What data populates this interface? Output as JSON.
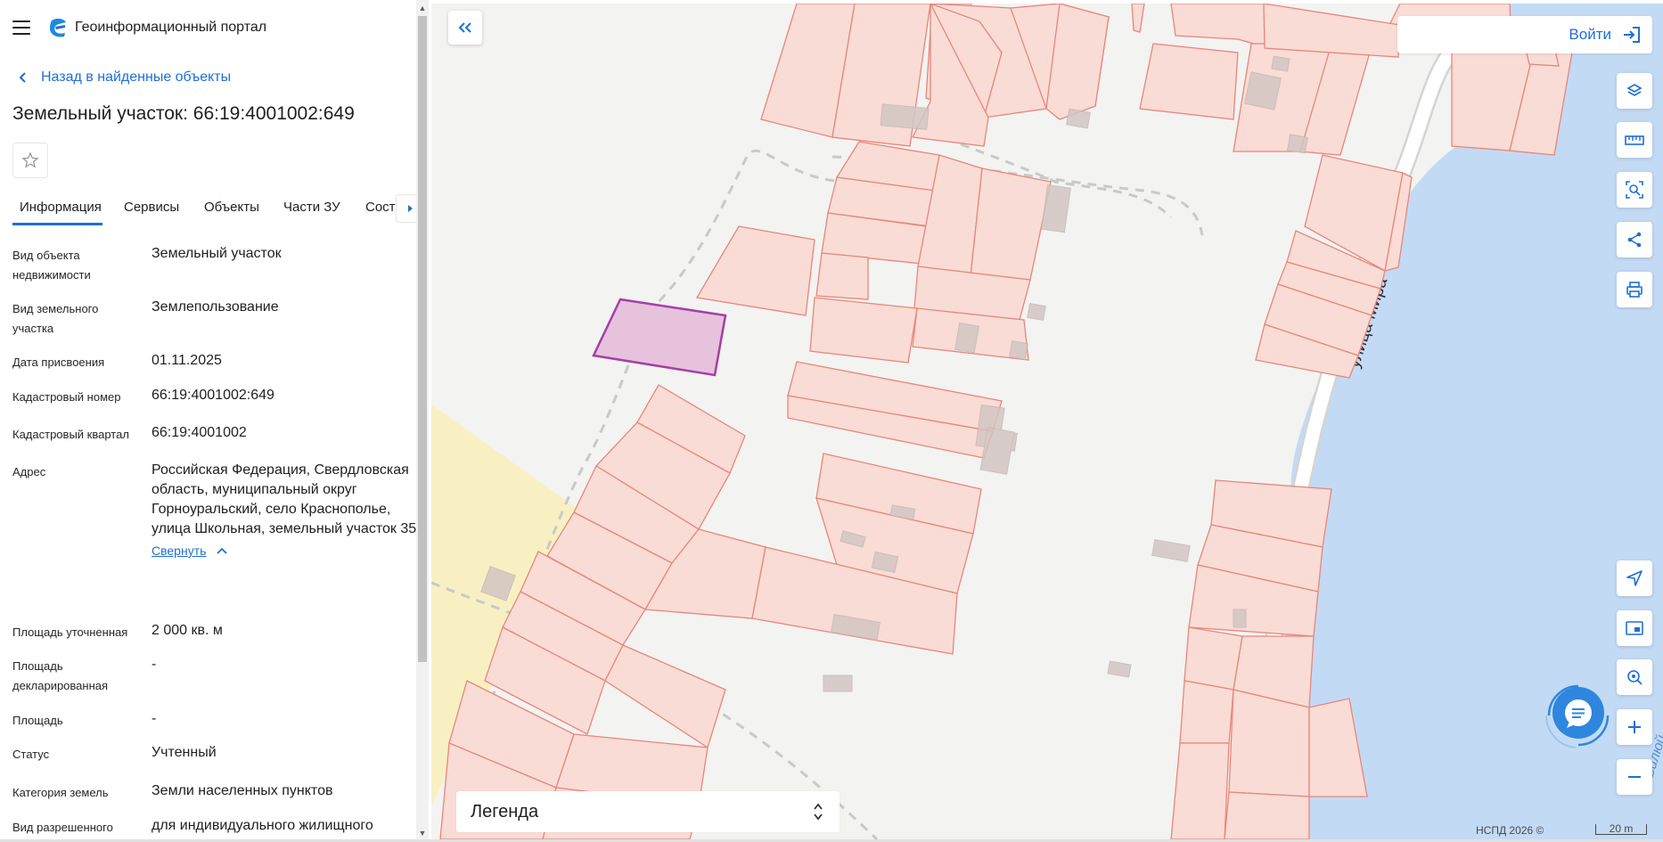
{
  "app": {
    "title": "Геоинформационный портал",
    "back_label": "Назад в найденные объекты",
    "object_title": "Земельный участок: 66:19:4001002:649"
  },
  "tabs": [
    {
      "label": "Информация",
      "active": true
    },
    {
      "label": "Сервисы",
      "active": false
    },
    {
      "label": "Объекты",
      "active": false
    },
    {
      "label": "Части ЗУ",
      "active": false
    },
    {
      "label": "Состав ЗУ",
      "active": false
    }
  ],
  "info": {
    "object_type": {
      "label": "Вид объекта недвижимости",
      "value": "Земельный участок"
    },
    "land_type": {
      "label": "Вид земельного участка",
      "value": "Землепользование"
    },
    "date_assigned": {
      "label": "Дата присвоения",
      "value": "01.11.2025"
    },
    "cadastral_number": {
      "label": "Кадастровый номер",
      "value": "66:19:4001002:649"
    },
    "cadastral_quarter": {
      "label": "Кадастровый квартал",
      "value": "66:19:4001002"
    },
    "address": {
      "label": "Адрес",
      "value": "Российская Федерация, Свердловская область, муниципальный округ Горноуральский, село Краснополье, улица Школьная, земельный участок 35",
      "collapse_label": "Свернуть"
    },
    "area_specified": {
      "label": "Площадь уточненная",
      "value": "2 000 кв. м"
    },
    "area_declared": {
      "label": "Площадь декларированная",
      "value": "-"
    },
    "area": {
      "label": "Площадь",
      "value": "-"
    },
    "status": {
      "label": "Статус",
      "value": "Учтенный"
    },
    "land_category": {
      "label": "Категория земель",
      "value": "Земли населенных пунктов"
    },
    "permitted_use": {
      "label": "Вид разрешенного",
      "value": "для индивидуального жилищного"
    }
  },
  "map": {
    "login_label": "Войти",
    "legend_label": "Легенда",
    "street_label": "улица Мира",
    "river_label": "Вилюй",
    "copyright": "НСПД 2026 ©",
    "scale_label": "20 m",
    "tools": [
      "layers-icon",
      "ruler-icon",
      "area-select-icon",
      "share-icon",
      "print-icon",
      "locate-icon",
      "minimap-icon",
      "search-point-icon",
      "zoom-in-icon",
      "zoom-out-icon"
    ]
  },
  "colors": {
    "accent": "#1e6fd6",
    "parcel_fill": "#f9dcd5",
    "parcel_stroke": "#e8867a",
    "selected_fill": "#e6c2dd",
    "selected_stroke": "#a43fa8",
    "water": "#c3daf5",
    "meadow": "#f8f0c2"
  }
}
